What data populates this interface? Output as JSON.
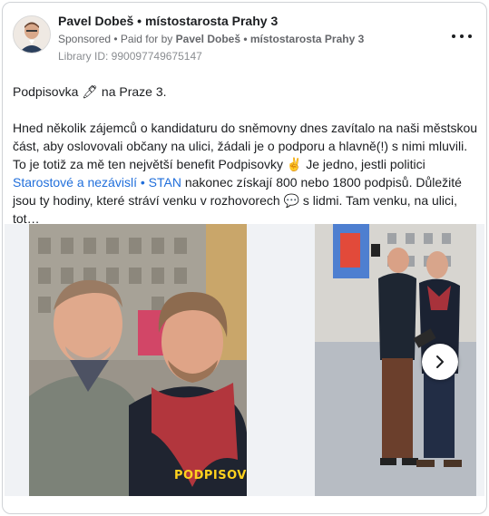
{
  "post": {
    "author": "Pavel Dobeš • místostarosta Prahy 3",
    "sponsored": "Sponsored",
    "paid_prefix": "• Paid for by",
    "paid_by": "Pavel Dobeš • místostarosta Prahy 3",
    "library_id": "Library ID: 990097749675147",
    "title_line": "Podpisovka 🖊 na Praze 3.",
    "body_part1": "Hned několik zájemců o kandidaturu do sněmovny dnes zavítalo na naši městskou část, aby oslovovali občany na ulici, žádali je o podporu a hlavně(!) s nimi mluvili. To je totiž za mě ten největší benefit Podpisovky ✌ Je jedno, jestli politici ",
    "body_link": "Starostové a nezávislí • STAN",
    "body_part2": " nakonec získají 800 nebo 1800 podpisů. Důležité jsou ty hodiny, které stráví venku v rozhovorech 💬 s lidmi. Tam venku, na ulici, tot…"
  },
  "media": {
    "slide1_label": "PODPISOVKA",
    "next_icon": "chevron-right-icon"
  },
  "colors": {
    "link": "#216fdb",
    "text": "#1c1e21",
    "muted": "#65676b",
    "logo": "#ffd21e"
  }
}
